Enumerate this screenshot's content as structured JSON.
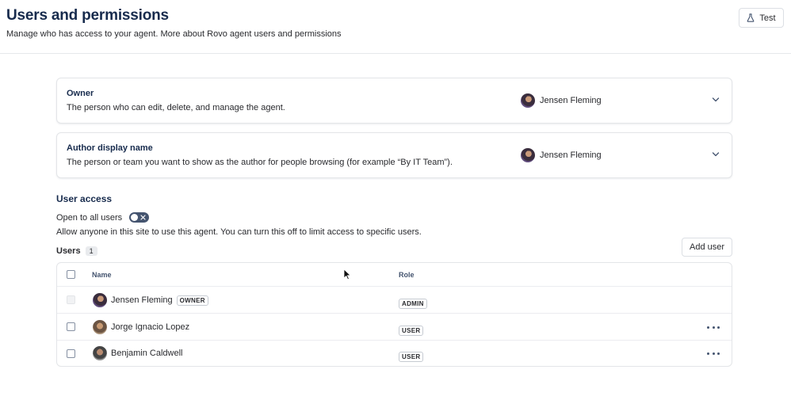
{
  "header": {
    "title": "Users and permissions",
    "subtitle": "Manage who has access to your agent. More about Rovo agent users and permissions",
    "test_button": {
      "label": "Test",
      "icon": "flask-icon"
    }
  },
  "owner_card": {
    "title": "Owner",
    "description": "The person who can edit, delete, and manage the agent.",
    "selected_user": "Jensen Fleming",
    "icon": "chevron-down-icon"
  },
  "author_card": {
    "title": "Author display name",
    "description": "The person or team you want to show as the author for people browsing (for example “By IT Team”).",
    "selected_user": "Jensen Fleming",
    "icon": "chevron-down-icon"
  },
  "user_access": {
    "title": "User access",
    "open_to_all_label": "Open to all users",
    "open_to_all_enabled": false,
    "description": "Allow anyone in this site to use this agent. You can turn this off to limit access to specific users.",
    "users_label": "Users",
    "users_count": "1",
    "add_user_label": "Add user"
  },
  "users_table": {
    "columns": [
      "Name",
      "Role"
    ],
    "rows": [
      {
        "name": "Jensen Fleming",
        "badge": "OWNER",
        "role": "ADMIN",
        "checkbox_disabled": true,
        "has_actions": false
      },
      {
        "name": "Jorge Ignacio Lopez",
        "badge": "",
        "role": "USER",
        "checkbox_disabled": false,
        "has_actions": true
      },
      {
        "name": "Benjamin Caldwell",
        "badge": "",
        "role": "USER",
        "checkbox_disabled": false,
        "has_actions": true
      }
    ]
  },
  "colors": {
    "text": "#172b4d",
    "border": "#e3e5e8",
    "toggle_off": "#44546f"
  }
}
